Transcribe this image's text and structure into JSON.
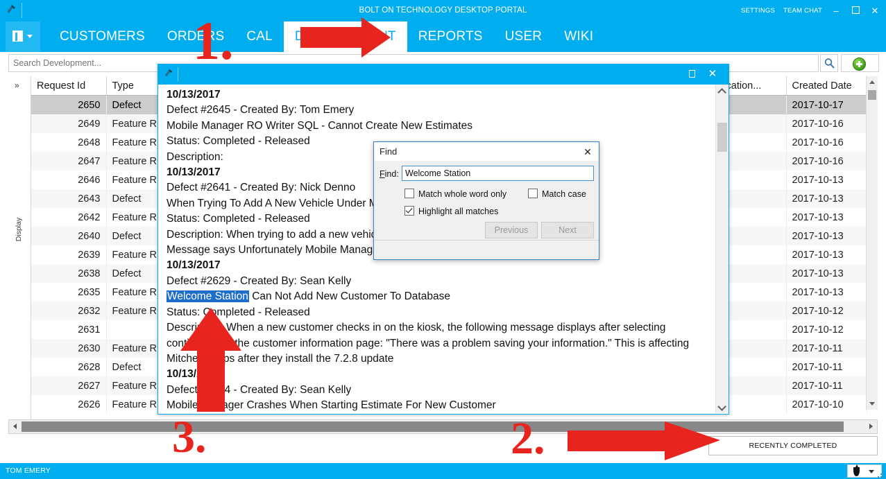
{
  "colors": {
    "brand_blue": "#00AEEF",
    "annotation_red": "#E8241E",
    "highlight_blue": "#1D6EC9",
    "selected_row": "#CCCCCC"
  },
  "titlebar": {
    "app_title": "BOLT ON TECHNOLOGY DESKTOP PORTAL",
    "settings_label": "SETTINGS",
    "team_chat_label": "TEAM CHAT",
    "minimize_glyph": "–",
    "maximize_glyph": "❑",
    "close_glyph": "✕",
    "logo_glyph": "🔧"
  },
  "nav": {
    "menu_button_name": "main-menu",
    "tabs": [
      {
        "label": "CUSTOMERS",
        "active": false
      },
      {
        "label": "ORDERS",
        "active": false
      },
      {
        "label": "CAL",
        "active": false
      },
      {
        "label": "DEVELOPMENT",
        "active": true
      },
      {
        "label": "REPORTS",
        "active": false
      },
      {
        "label": "USER",
        "active": false
      },
      {
        "label": "WIKI",
        "active": false
      }
    ]
  },
  "search": {
    "placeholder": "Search Development...",
    "value": "",
    "search_icon": "search-icon",
    "add_icon": "add-plus-icon"
  },
  "grid": {
    "gutter_label": "Display",
    "expand_glyph": "»",
    "columns": [
      "Request Id",
      "Type",
      "Notification...",
      "Created Date"
    ],
    "rows": [
      {
        "id": "2650",
        "type": "Defect",
        "notification": "",
        "created": "2017-10-17",
        "selected": true
      },
      {
        "id": "2649",
        "type": "Feature R",
        "notification": "",
        "created": "2017-10-16",
        "selected": false
      },
      {
        "id": "2648",
        "type": "Feature R",
        "notification": "",
        "created": "2017-10-16",
        "selected": false
      },
      {
        "id": "2647",
        "type": "Feature R",
        "notification": "",
        "created": "2017-10-16",
        "selected": false
      },
      {
        "id": "2646",
        "type": "Feature R",
        "notification": "",
        "created": "2017-10-13",
        "selected": false
      },
      {
        "id": "2643",
        "type": "Defect",
        "notification": "",
        "created": "2017-10-13",
        "selected": false
      },
      {
        "id": "2642",
        "type": "Feature R",
        "notification": "",
        "created": "2017-10-13",
        "selected": false
      },
      {
        "id": "2640",
        "type": "Defect",
        "notification": "",
        "created": "2017-10-13",
        "selected": false
      },
      {
        "id": "2639",
        "type": "Feature R",
        "notification": "",
        "created": "2017-10-13",
        "selected": false
      },
      {
        "id": "2638",
        "type": "Defect",
        "notification": "",
        "created": "2017-10-13",
        "selected": false
      },
      {
        "id": "2635",
        "type": "Feature R",
        "notification": "",
        "created": "2017-10-13",
        "selected": false
      },
      {
        "id": "2632",
        "type": "Feature R",
        "notification": "",
        "created": "2017-10-12",
        "selected": false
      },
      {
        "id": "2631",
        "type": "",
        "notification": "",
        "created": "2017-10-12",
        "selected": false
      },
      {
        "id": "2630",
        "type": "Feature R",
        "notification": "",
        "created": "2017-10-11",
        "selected": false
      },
      {
        "id": "2628",
        "type": "Defect",
        "notification": "",
        "created": "2017-10-11",
        "selected": false
      },
      {
        "id": "2627",
        "type": "Feature R",
        "notification": "",
        "created": "2017-10-11",
        "selected": false
      },
      {
        "id": "2626",
        "type": "Feature R",
        "notification": "",
        "created": "2017-10-10",
        "selected": false
      }
    ]
  },
  "recently_completed": {
    "label": "RECENTLY COMPLETED"
  },
  "statusbar": {
    "user": "TOM EMERY"
  },
  "child_window": {
    "close_glyph": "✕",
    "entries": [
      {
        "date": "10/13/2017",
        "defect": "Defect #2645 - Created By: Tom Emery",
        "summary": "Mobile Manager RO Writer SQL - Cannot Create New Estimates",
        "status": "Status: Completed - Released",
        "description": "Description:"
      },
      {
        "date": "10/13/2017",
        "defect": "Defect #2641 - Created By: Nick Denno",
        "summary": "When Trying To Add A New Vehicle Under Mobile Manager It Shuts Down.",
        "status": "Status: Completed - Released",
        "description": "Description: When trying to add a new vehicle in Mobile Manager Shuts Down.",
        "description2": "Message says Unfortunately Mobile Manager has stopped."
      },
      {
        "date": "10/13/2017",
        "defect": "Defect #2629 - Created By: Sean Kelly",
        "summary_highlight": "Welcome Station",
        "summary_rest": " Can Not Add New Customer To Database",
        "status": "Status: Completed - Released",
        "description": "Description: When a new customer checks in on the kiosk, the following message displays after selecting continue from the customer information page: \"There was a problem saving your information.\" This is affecting Mitchell shops after they install the 7.2.8 update"
      },
      {
        "date": "10/13/2017",
        "defect": "Defect #2634 - Created By: Sean Kelly",
        "summary": "Mobile Manager Crashes When Starting Estimate For New Customer"
      }
    ]
  },
  "find_dialog": {
    "title": "Find",
    "close_glyph": "✕",
    "find_label": "Find:",
    "find_value": "Welcome Station",
    "match_whole_word_label": "Match whole word only",
    "match_whole_word_checked": false,
    "match_case_label": "Match case",
    "match_case_checked": false,
    "highlight_all_label": "Highlight all matches",
    "highlight_all_checked": true,
    "previous_label": "Previous",
    "next_label": "Next"
  },
  "annotations": {
    "step1": "1.",
    "step2": "2.",
    "step3": "3."
  }
}
